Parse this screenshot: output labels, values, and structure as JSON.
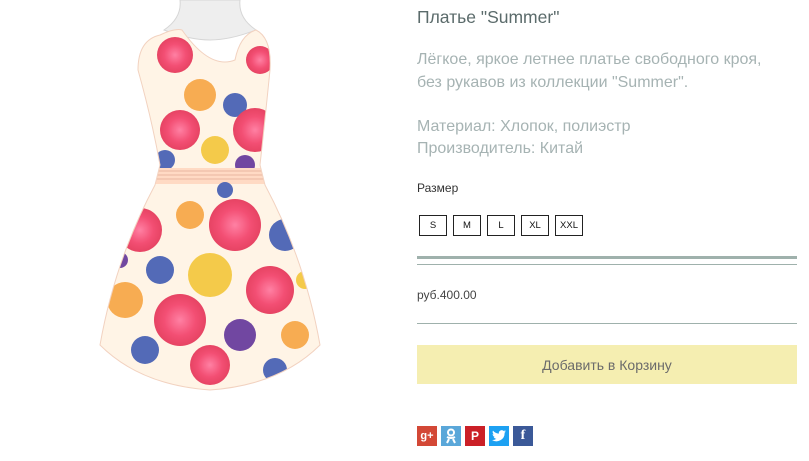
{
  "product": {
    "title": "Платье \"Summer\"",
    "description_lines": [
      "Лёгкое, яркое летнее платье свободного кроя,",
      "без рукавов из коллекции \"Summer\"."
    ],
    "specs": [
      "Материал: Хлопок, полиэстр",
      "Производитель: Китай"
    ],
    "size_label": "Размер",
    "sizes": [
      "S",
      "M",
      "L",
      "XL",
      "XXL"
    ],
    "price": "руб.400.00",
    "add_to_cart_label": "Добавить в Корзину"
  },
  "social": {
    "buttons": [
      {
        "icon": "google-plus-icon",
        "glyph": "g+",
        "color": "#d34836"
      },
      {
        "icon": "odnoklassniki-icon",
        "glyph": "",
        "color": "#5aa7d9"
      },
      {
        "icon": "pinterest-icon",
        "glyph": "P",
        "color": "#cb2027"
      },
      {
        "icon": "twitter-icon",
        "glyph": "",
        "color": "#1da1f2"
      },
      {
        "icon": "facebook-icon",
        "glyph": "f",
        "color": "#3b5998"
      }
    ]
  },
  "colors": {
    "add_to_cart_bg": "#f5eeb1",
    "divider": "#9fb1ac",
    "description_text": "#a6b3b3"
  }
}
